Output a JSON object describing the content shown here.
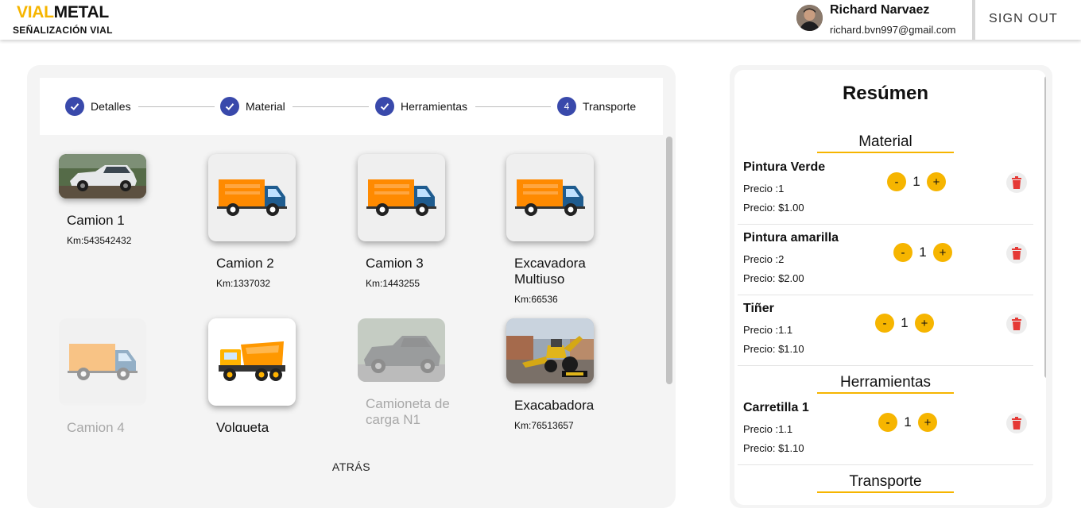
{
  "header": {
    "logo_part1": "VIAL",
    "logo_part2": "METAL",
    "tagline": "SEÑALIZACIÓN VIAL",
    "user_name": "Richard Narvaez",
    "user_email": "richard.bvn997@gmail.com",
    "signout_label": "SIGN OUT"
  },
  "stepper": {
    "steps": [
      {
        "label": "Detalles",
        "state": "done"
      },
      {
        "label": "Material",
        "state": "done"
      },
      {
        "label": "Herramientas",
        "state": "done"
      },
      {
        "label": "Transporte",
        "state": "active",
        "number": "4"
      }
    ]
  },
  "vehicles": [
    {
      "name": "Camion 1",
      "km": "Km:543542432",
      "image": "pickup-photo",
      "disabled": false
    },
    {
      "name": "Camion 2",
      "km": "Km:1337032",
      "image": "truck-icon",
      "disabled": false
    },
    {
      "name": "Camion 3",
      "km": "Km:1443255",
      "image": "truck-icon",
      "disabled": false
    },
    {
      "name": "Excavadora Multiuso",
      "km": "Km:66536",
      "image": "truck-icon",
      "disabled": false
    },
    {
      "name": "Camion 4",
      "km": "",
      "image": "truck-icon",
      "disabled": true
    },
    {
      "name": "Volqueta",
      "km": "",
      "image": "dump-truck-icon",
      "disabled": false
    },
    {
      "name": "Camioneta de carga N1",
      "km": "",
      "image": "pickup-photo",
      "disabled": true
    },
    {
      "name": "Exacabadora",
      "km": "Km:76513657",
      "image": "backhoe-photo",
      "disabled": false
    }
  ],
  "back_label": "ATRÁS",
  "summary": {
    "title": "Resúmen",
    "sections": {
      "material": "Material",
      "tools": "Herramientas",
      "transport": "Transporte"
    },
    "items": [
      {
        "name": "Pintura Verde",
        "qty_text": "Precio :1",
        "price_text": "Precio: $1.00",
        "count": "1"
      },
      {
        "name": "Pintura amarilla",
        "qty_text": "Precio :2",
        "price_text": "Precio: $2.00",
        "count": "1"
      },
      {
        "name": "Tiñer",
        "qty_text": "Precio :1.1",
        "price_text": "Precio: $1.10",
        "count": "1"
      },
      {
        "name": "Carretilla 1",
        "qty_text": "Precio :1.1",
        "price_text": "Precio: $1.10",
        "count": "1"
      }
    ],
    "minus_label": "-",
    "plus_label": "+"
  },
  "colors": {
    "brand_yellow": "#f6b500",
    "step_blue": "#3949ab",
    "delete_red": "#e53935"
  }
}
